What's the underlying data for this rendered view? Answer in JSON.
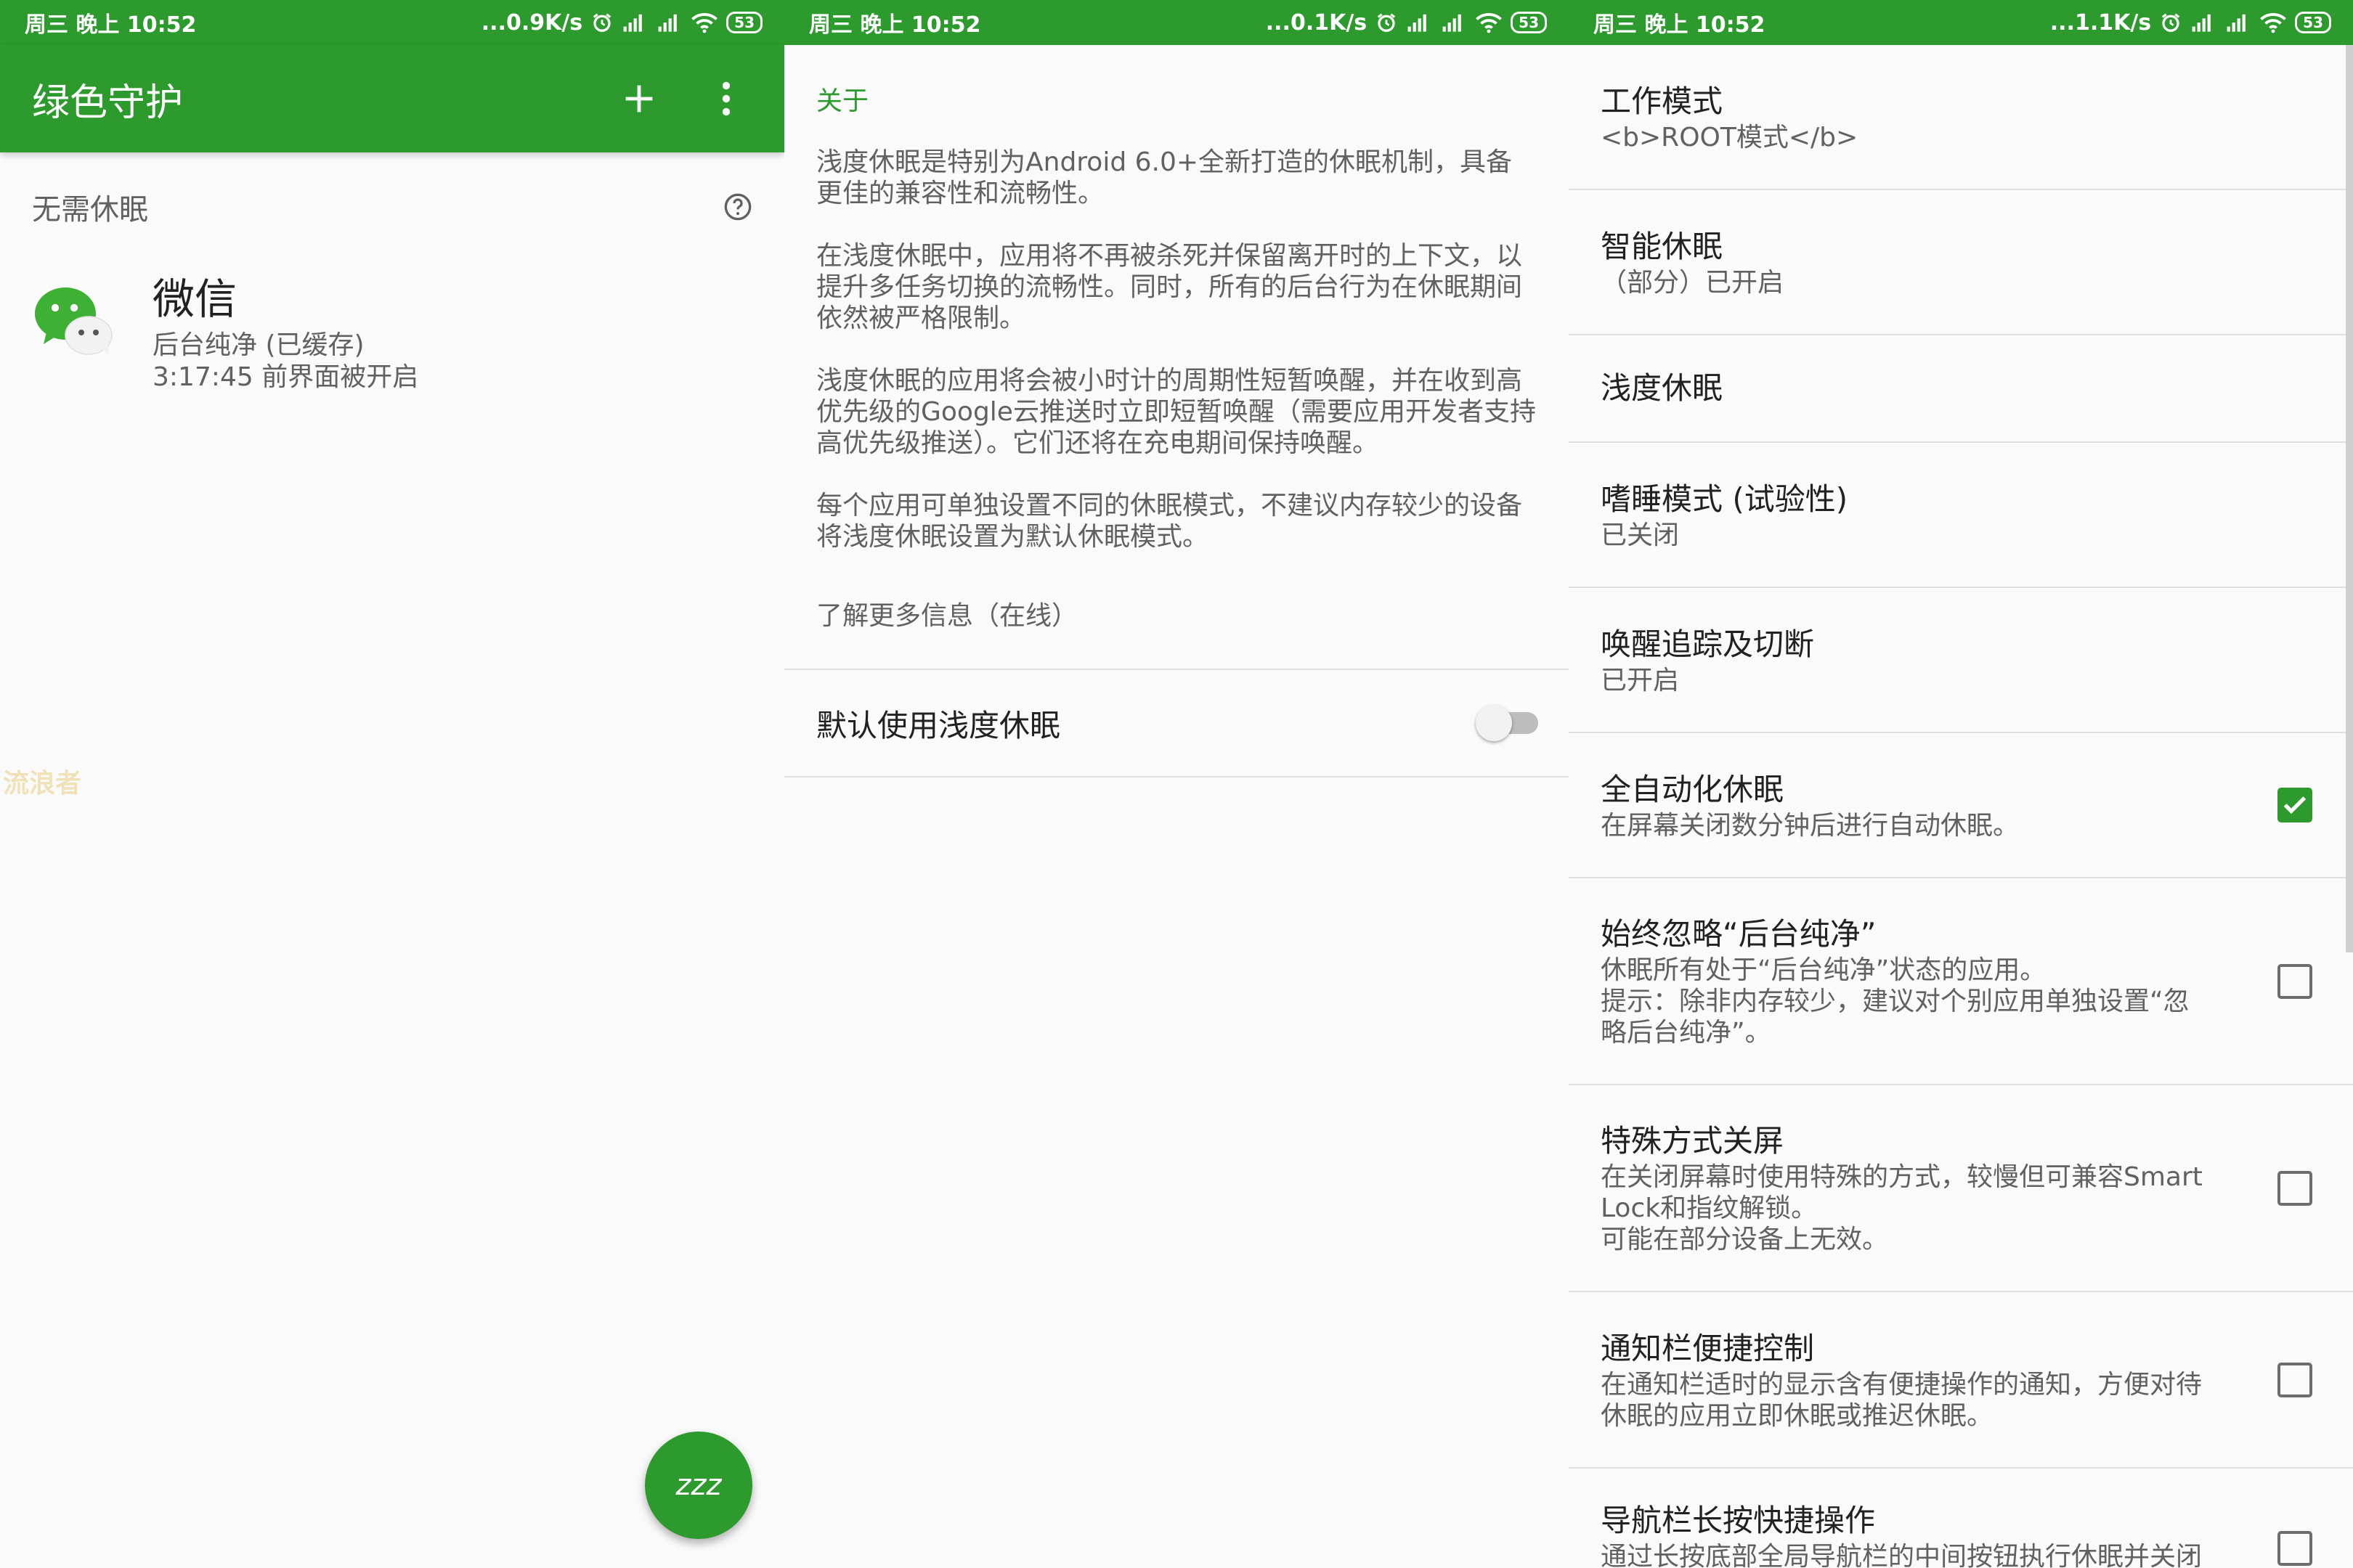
{
  "status_bars": [
    {
      "time": "周三 晚上 10:52",
      "speed": "...0.9K/s",
      "battery": "53"
    },
    {
      "time": "周三 晚上 10:52",
      "speed": "...0.1K/s",
      "battery": "53"
    },
    {
      "time": "周三 晚上 10:52",
      "speed": "...1.1K/s",
      "battery": "53"
    }
  ],
  "main": {
    "title": "绿色守护",
    "add_icon": "plus-icon",
    "more_icon": "more-vert-icon",
    "section_title": "无需休眠",
    "help_icon": "help-circle-icon",
    "app": {
      "name": "微信",
      "status": "后台纯净 (已缓存)",
      "detail": "3:17:45 前界面被开启"
    },
    "fab_label": "zzz",
    "watermark": "流浪者"
  },
  "about": {
    "title": "关于",
    "paragraphs": [
      "浅度休眠是特别为Android 6.0+全新打造的休眠机制，具备更佳的兼容性和流畅性。",
      "在浅度休眠中，应用将不再被杀死并保留离开时的上下文，以提升多任务切换的流畅性。同时，所有的后台行为在休眠期间依然被严格限制。",
      "浅度休眠的应用将会被小时计的周期性短暂唤醒，并在收到高优先级的Google云推送时立即短暂唤醒（需要应用开发者支持高优先级推送）。它们还将在充电期间保持唤醒。",
      "每个应用可单独设置不同的休眠模式，不建议内存较少的设备将浅度休眠设置为默认休眠模式。"
    ],
    "learn_more": "了解更多信息（在线）",
    "default_toggle": {
      "label": "默认使用浅度休眠",
      "on": false
    }
  },
  "settings": [
    {
      "title": "工作模式",
      "summary": "<b>ROOT模式</b>",
      "checkbox": null
    },
    {
      "title": "智能休眠",
      "summary": "（部分）已开启",
      "checkbox": null
    },
    {
      "title": "浅度休眠",
      "summary": "",
      "checkbox": null
    },
    {
      "title": "嗜睡模式 (试验性)",
      "summary": "已关闭",
      "checkbox": null
    },
    {
      "title": "唤醒追踪及切断",
      "summary": "已开启",
      "checkbox": null
    },
    {
      "title": "全自动化休眠",
      "summary": "在屏幕关闭数分钟后进行自动休眠。",
      "checkbox": true
    },
    {
      "title": "始终忽略“后台纯净”",
      "summary": "休眠所有处于“后台纯净”状态的应用。\n提示：除非内存较少，建议对个别应用单独设置“忽略后台纯净”。",
      "checkbox": false
    },
    {
      "title": "特殊方式关屏",
      "summary": "在关闭屏幕时使用特殊的方式，较慢但可兼容Smart Lock和指纹解锁。\n可能在部分设备上无效。",
      "checkbox": false
    },
    {
      "title": "通知栏便捷控制",
      "summary": "在通知栏适时的显示含有便捷操作的通知，方便对待休眠的应用立即休眠或推迟休眠。",
      "checkbox": false
    },
    {
      "title": "导航栏长按快捷操作",
      "summary": "通过长按底部全局导航栏的中间按钮执行休眠并关闭",
      "checkbox": false
    }
  ]
}
